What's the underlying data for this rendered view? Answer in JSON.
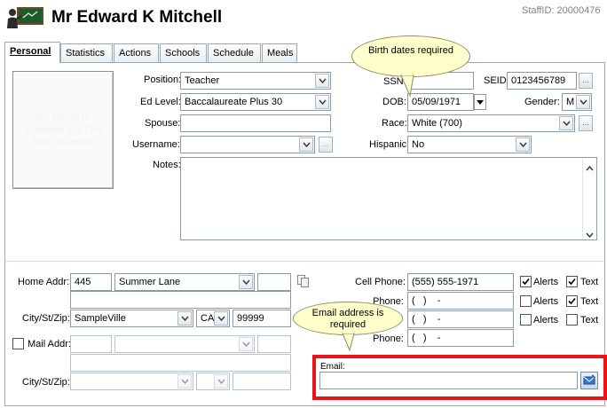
{
  "header": {
    "name": "Mr Edward K Mitchell",
    "staff_id": "StaffID: 20000476"
  },
  "tabs": [
    {
      "label": "Personal",
      "active": true
    },
    {
      "label": "Statistics"
    },
    {
      "label": "Actions"
    },
    {
      "label": "Schools"
    },
    {
      "label": "Schedule"
    },
    {
      "label": "Meals"
    }
  ],
  "photo": {
    "text": "No Photo is Available for This Staff Member"
  },
  "fields": {
    "position": {
      "label": "Position:",
      "value": "Teacher"
    },
    "ed_level": {
      "label": "Ed Level:",
      "value": "Baccalaureate Plus 30"
    },
    "spouse": {
      "label": "Spouse:",
      "value": ""
    },
    "username": {
      "label": "Username:",
      "value": ""
    },
    "notes": {
      "label": "Notes:",
      "value": ""
    },
    "ssn": {
      "label": "SSN:",
      "value": ""
    },
    "seid": {
      "label": "SEID:",
      "value": "0123456789"
    },
    "dob": {
      "label": "DOB:",
      "value": "05/09/1971"
    },
    "gender": {
      "label": "Gender:",
      "value": "M"
    },
    "race": {
      "label": "Race:",
      "value": "White (700)"
    },
    "hispanic": {
      "label": "Hispanic:",
      "value": "No"
    }
  },
  "address": {
    "home_label": "Home Addr:",
    "number": "445",
    "street": "Summer Lane",
    "city_label": "City/St/Zip:",
    "city": "SampleVille",
    "state": "CA",
    "zip": "99999",
    "mail_label": "Mail Addr:",
    "mail_city_label": "City/St/Zip:"
  },
  "phones": {
    "cell_label": "Cell Phone:",
    "cell_value": "(555) 555-1971",
    "phone_label": "Phone:",
    "phone_placeholder": "(   )    -",
    "alerts_label": "Alerts",
    "text_label": "Text",
    "rows": [
      {
        "alerts": true,
        "text": true
      },
      {
        "alerts": false,
        "text": true
      },
      {
        "alerts": false,
        "text": false
      }
    ]
  },
  "email": {
    "label": "Email:",
    "value": ""
  },
  "callouts": {
    "birth": "Birth dates required",
    "email": "Email address is required"
  },
  "colors": {
    "highlight": "#e8161b",
    "callout_fill": "#ffffcc"
  }
}
